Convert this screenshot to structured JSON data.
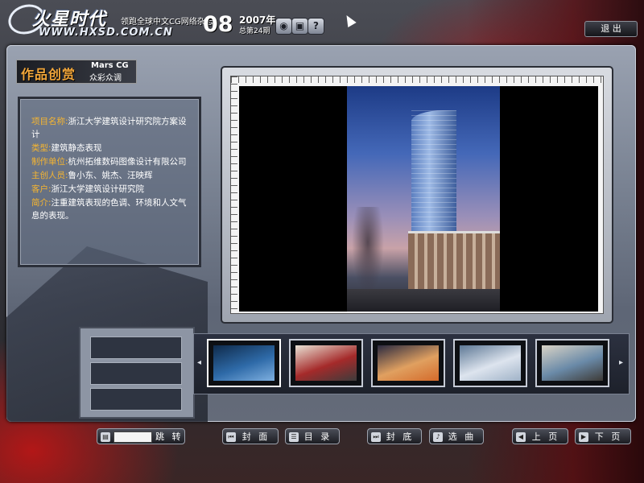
{
  "header": {
    "logo_text": "火星时代",
    "logo_url": "WWW.HXSD.COM.CN",
    "tagline": "领跑全球中文CG网络杂志",
    "issue_number": "08",
    "issue_year": "2007年",
    "issue_total": "总第24期",
    "icons": [
      "disc-icon",
      "cube-icon",
      "help-icon"
    ],
    "exit_label": "退 出"
  },
  "section": {
    "title_zh": "作品创赏",
    "title_en": "Mars CG",
    "subtitle": "众彩众调"
  },
  "info": {
    "project_label": "项目名称:",
    "project_value": "浙江大学建筑设计研究院方案设计",
    "type_label": "类型:",
    "type_value": "建筑静态表现",
    "maker_label": "制作单位:",
    "maker_value": "杭州拓维数码图像设计有限公司",
    "creators_label": "主创人员:",
    "creators_value": "鲁小东、姚杰、汪映辉",
    "client_label": "客户:",
    "client_value": "浙江大学建筑设计研究院",
    "intro_label": "简介:",
    "intro_value": "注重建筑表现的色调、环境和人文气息的表现。"
  },
  "thumbnails": {
    "prev_label": "◂",
    "next_label": "▸",
    "items": [
      {
        "colors": [
          "#0f2a4a",
          "#2e6aa8",
          "#7fb0e0"
        ]
      },
      {
        "colors": [
          "#e9e2d5",
          "#a52a2a",
          "#3c3c3c"
        ]
      },
      {
        "colors": [
          "#2a2a40",
          "#e0a060",
          "#d46a2a"
        ]
      },
      {
        "colors": [
          "#5d7895",
          "#dde4ee",
          "#9fb2c7"
        ]
      },
      {
        "colors": [
          "#d9d3c6",
          "#6a8aa8",
          "#3d3a36"
        ]
      }
    ]
  },
  "footer": {
    "jump_label": "跳 转",
    "cover_label": "封 面",
    "toc_label": "目 录",
    "back_cover_label": "封 底",
    "music_label": "选 曲",
    "prev_page_label": "上 页",
    "next_page_label": "下 页"
  },
  "colors": {
    "accent_label": "#f5b531",
    "section_title": "#f2a63a",
    "brand_red": "#b3141c"
  }
}
